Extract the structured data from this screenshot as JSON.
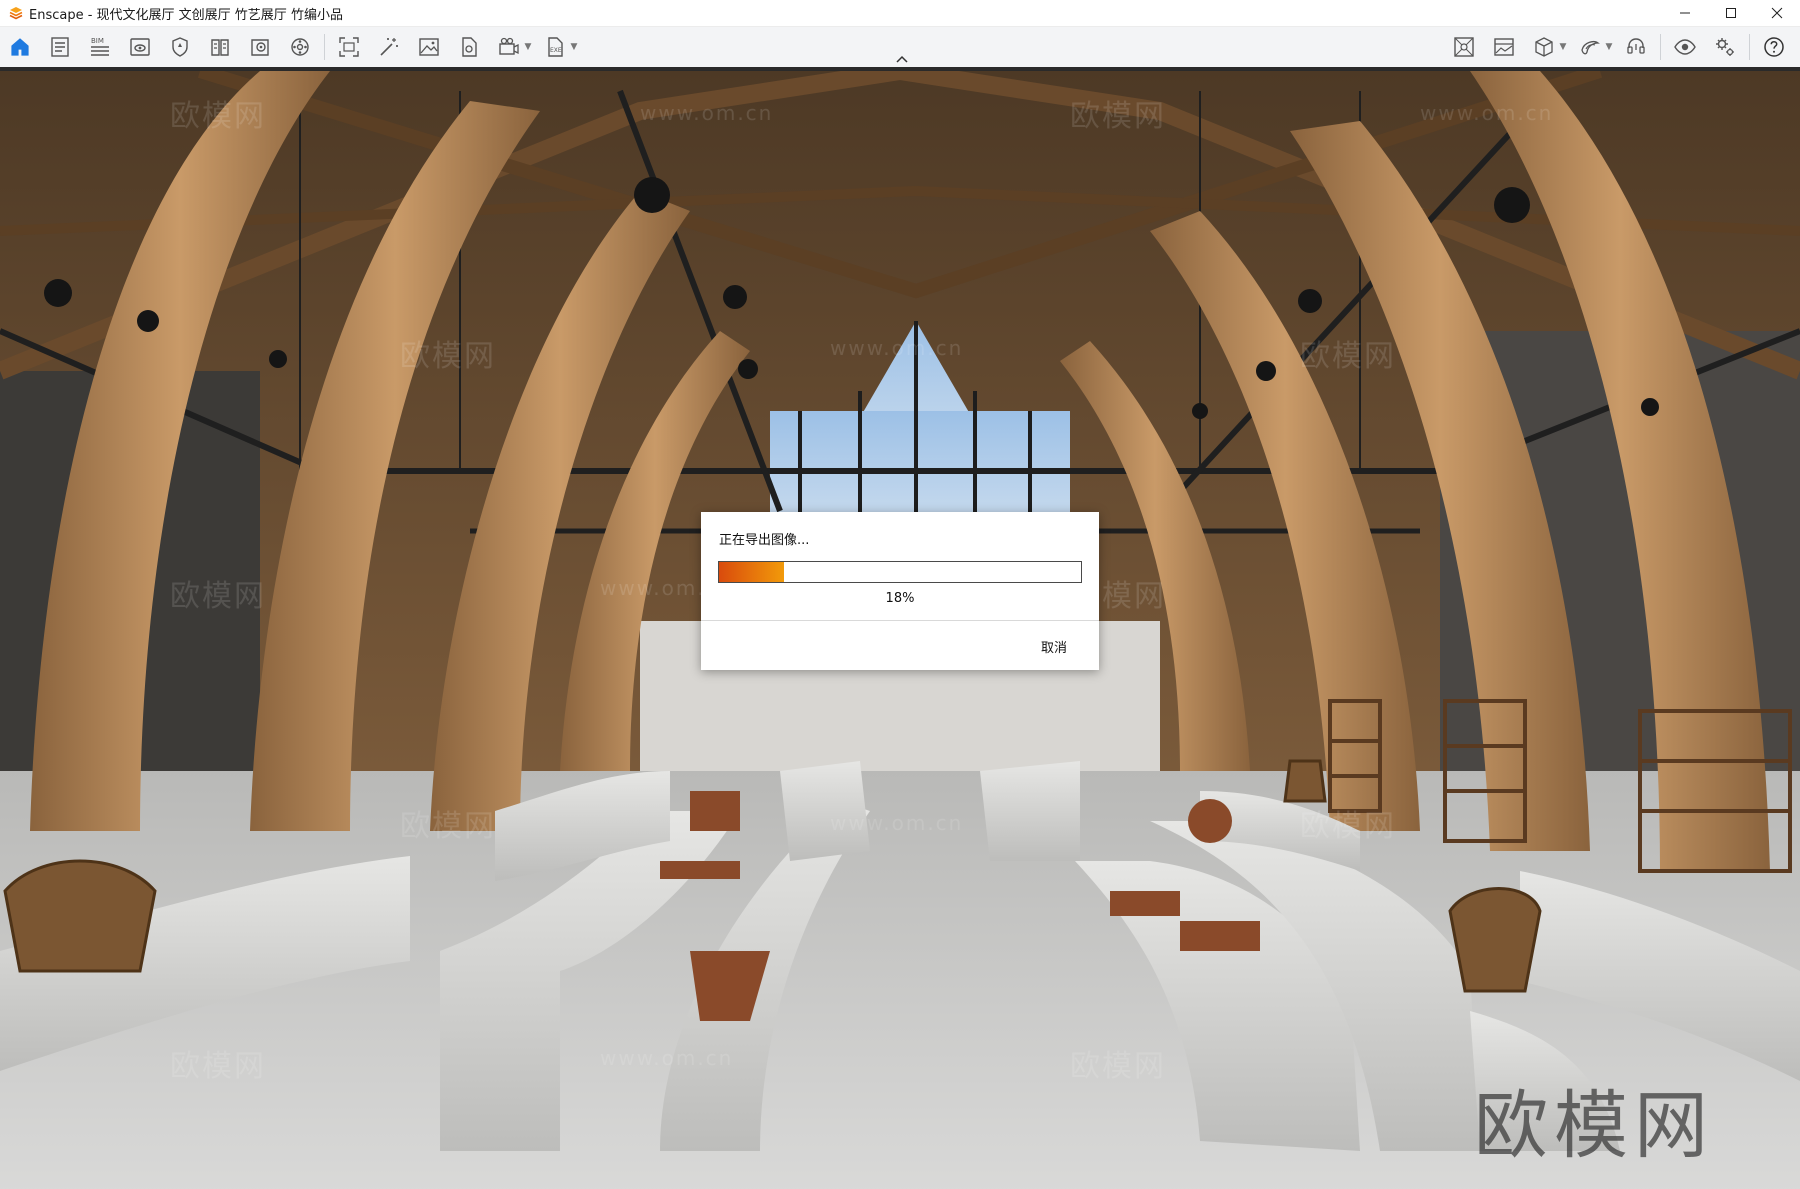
{
  "window": {
    "app_name": "Enscape",
    "title": "Enscape - 现代文化展厅 文创展厅 竹艺展厅 竹编小品",
    "controls": [
      "minimize-icon",
      "maximize-icon",
      "close-icon"
    ]
  },
  "toolbar": {
    "left_items": [
      {
        "name": "home",
        "icon": "home-icon",
        "active": true
      },
      {
        "name": "project-info",
        "icon": "document-lines-icon"
      },
      {
        "name": "bim",
        "icon": "bim-icon",
        "label": "BIM"
      },
      {
        "name": "visual-settings",
        "icon": "eye-window-icon"
      },
      {
        "name": "assets",
        "icon": "shield-asset-icon"
      },
      {
        "name": "material-library",
        "icon": "book-icon"
      },
      {
        "name": "material-editor",
        "icon": "palette-book-icon"
      },
      {
        "name": "atmosphere",
        "icon": "gear-circle-icon"
      },
      {
        "name": "capture-view",
        "icon": "crop-frame-icon"
      },
      {
        "name": "magic-tool",
        "icon": "wand-icon"
      },
      {
        "name": "image-export",
        "icon": "image-icon"
      },
      {
        "name": "batch-render",
        "icon": "file-tag-icon"
      },
      {
        "name": "video",
        "icon": "camera-film-icon",
        "dropdown": true
      },
      {
        "name": "export-exe",
        "icon": "exe-file-icon",
        "dropdown": true
      }
    ],
    "right_items": [
      {
        "name": "fullscreen",
        "icon": "grid-square-icon"
      },
      {
        "name": "panorama",
        "icon": "landscape-frame-icon"
      },
      {
        "name": "view-cube",
        "icon": "cube-icon",
        "dropdown": true
      },
      {
        "name": "vr-tool",
        "icon": "swirl-icon",
        "dropdown": true
      },
      {
        "name": "collaboration",
        "icon": "headset-icon"
      },
      {
        "name": "preview",
        "icon": "eye-icon"
      },
      {
        "name": "settings",
        "icon": "gears-icon"
      },
      {
        "name": "help",
        "icon": "question-icon"
      }
    ],
    "accent_color": "#1f7ae0"
  },
  "viewport": {
    "watermarks": [
      "欧模网",
      "www.om.cn"
    ],
    "brand_watermark": "欧模网"
  },
  "dialog": {
    "title": "正在导出图像...",
    "progress": 0.18,
    "progress_text": "18%",
    "cancel_label": "取消",
    "progress_colors": [
      "#d94b0d",
      "#f29a0a"
    ]
  }
}
